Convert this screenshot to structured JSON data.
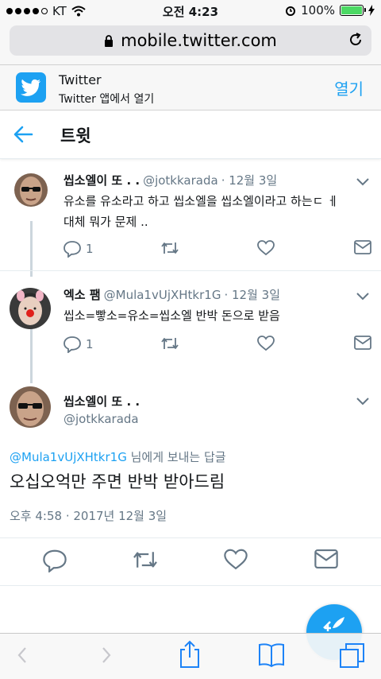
{
  "status": {
    "carrier": "KT",
    "time": "오전 4:23",
    "battery": "100%",
    "battery_level": 1.0
  },
  "browser": {
    "url": "mobile.twitter.com"
  },
  "app_banner": {
    "name": "Twitter",
    "subtitle": "Twitter 앱에서 열기",
    "open_label": "열기"
  },
  "header": {
    "title": "트윗"
  },
  "tweets": [
    {
      "name": "씹소엘이 또 . .",
      "handle": "@jotkkarada",
      "date": "· 12월 3일",
      "text_lines": [
        "유소를 유소라고 하고 씹소엘을 씹소엘이라고 하는ㄷ ㅔ",
        "대체 뭐가 문제 .."
      ],
      "replies": "1"
    },
    {
      "name": "엑소 팸",
      "handle": "@Mula1vUjXHtkr1G",
      "date": "· 12월 3일",
      "text_lines": [
        "씹소=빻소=유소=씹소엘 반박 돈으로 받음"
      ],
      "replies": "1"
    }
  ],
  "focused": {
    "name": "씹소엘이 또 . .",
    "handle": "@jotkkarada",
    "reply_mention": "@Mula1vUjXHtkr1G",
    "reply_suffix": " 님에게 보내는 답글",
    "text": "오십오억만 주면 반박 받아드림",
    "timestamp": "오후 4:58 · 2017년 12월 3일"
  },
  "colors": {
    "accent": "#1da1f2",
    "secondary": "#657786",
    "battery": "#4cd964"
  }
}
